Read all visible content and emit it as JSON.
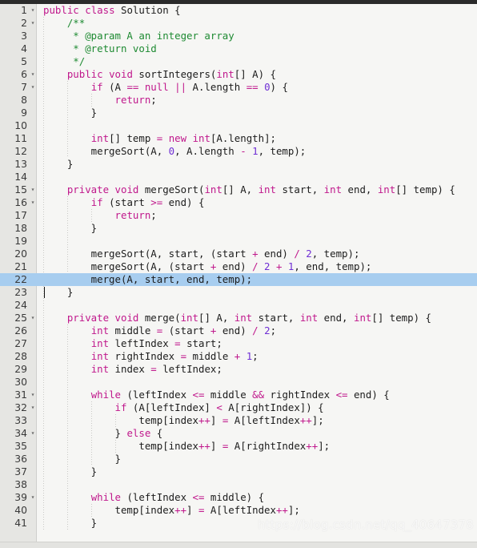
{
  "editor": {
    "language": "java",
    "theme": "light",
    "gutter_width": 46,
    "line_height": 16,
    "highlight_line": 22,
    "cursor_line": 23,
    "colors": {
      "background": "#f6f6f4",
      "gutter": "#e6e6e3",
      "top_bar": "#2b2b2b",
      "bottom_bar": "#e3e3e0",
      "selection": "#a7cdef",
      "keyword": "#c0188c",
      "comment": "#1e8a32",
      "number": "#6f2fd4",
      "operator": "#c0188c",
      "plain": "#1c1c1c",
      "line_number": "#3a3a3a"
    }
  },
  "watermark": {
    "text": "https://blog.csdn.net/qq_40647378"
  },
  "lines": [
    {
      "n": "1",
      "fold": true,
      "indent": 0,
      "tokens": [
        {
          "t": "public",
          "c": "kw"
        },
        {
          "t": " ",
          "c": "pl"
        },
        {
          "t": "class",
          "c": "kw"
        },
        {
          "t": " Solution {",
          "c": "pl"
        }
      ]
    },
    {
      "n": "2",
      "fold": true,
      "indent": 1,
      "tokens": [
        {
          "t": "    /**",
          "c": "cmt"
        }
      ]
    },
    {
      "n": "3",
      "fold": false,
      "indent": 1,
      "tokens": [
        {
          "t": "     * @param A an integer array",
          "c": "cmt"
        }
      ]
    },
    {
      "n": "4",
      "fold": false,
      "indent": 1,
      "tokens": [
        {
          "t": "     * @return void",
          "c": "cmt"
        }
      ]
    },
    {
      "n": "5",
      "fold": false,
      "indent": 1,
      "tokens": [
        {
          "t": "     */",
          "c": "cmt"
        }
      ]
    },
    {
      "n": "6",
      "fold": true,
      "indent": 1,
      "tokens": [
        {
          "t": "    ",
          "c": "pl"
        },
        {
          "t": "public",
          "c": "kw"
        },
        {
          "t": " ",
          "c": "pl"
        },
        {
          "t": "void",
          "c": "kw"
        },
        {
          "t": " sortIntegers(",
          "c": "pl"
        },
        {
          "t": "int",
          "c": "type"
        },
        {
          "t": "[] A) {",
          "c": "pl"
        }
      ]
    },
    {
      "n": "7",
      "fold": true,
      "indent": 2,
      "tokens": [
        {
          "t": "        ",
          "c": "pl"
        },
        {
          "t": "if",
          "c": "kw"
        },
        {
          "t": " (A ",
          "c": "pl"
        },
        {
          "t": "==",
          "c": "op"
        },
        {
          "t": " ",
          "c": "pl"
        },
        {
          "t": "null",
          "c": "kw"
        },
        {
          "t": " ",
          "c": "pl"
        },
        {
          "t": "||",
          "c": "op"
        },
        {
          "t": " A.length ",
          "c": "pl"
        },
        {
          "t": "==",
          "c": "op"
        },
        {
          "t": " ",
          "c": "pl"
        },
        {
          "t": "0",
          "c": "num"
        },
        {
          "t": ") {",
          "c": "pl"
        }
      ]
    },
    {
      "n": "8",
      "fold": false,
      "indent": 3,
      "tokens": [
        {
          "t": "            ",
          "c": "pl"
        },
        {
          "t": "return",
          "c": "kw"
        },
        {
          "t": ";",
          "c": "pl"
        }
      ]
    },
    {
      "n": "9",
      "fold": false,
      "indent": 2,
      "tokens": [
        {
          "t": "        }",
          "c": "pl"
        }
      ]
    },
    {
      "n": "10",
      "fold": false,
      "indent": 0,
      "tokens": [
        {
          "t": "",
          "c": "pl"
        }
      ]
    },
    {
      "n": "11",
      "fold": false,
      "indent": 2,
      "tokens": [
        {
          "t": "        ",
          "c": "pl"
        },
        {
          "t": "int",
          "c": "type"
        },
        {
          "t": "[] temp ",
          "c": "pl"
        },
        {
          "t": "=",
          "c": "op"
        },
        {
          "t": " ",
          "c": "pl"
        },
        {
          "t": "new",
          "c": "kw"
        },
        {
          "t": " ",
          "c": "pl"
        },
        {
          "t": "int",
          "c": "type"
        },
        {
          "t": "[A.length];",
          "c": "pl"
        }
      ]
    },
    {
      "n": "12",
      "fold": false,
      "indent": 2,
      "tokens": [
        {
          "t": "        mergeSort(A, ",
          "c": "pl"
        },
        {
          "t": "0",
          "c": "num"
        },
        {
          "t": ", A.length ",
          "c": "pl"
        },
        {
          "t": "-",
          "c": "op"
        },
        {
          "t": " ",
          "c": "pl"
        },
        {
          "t": "1",
          "c": "num"
        },
        {
          "t": ", temp);",
          "c": "pl"
        }
      ]
    },
    {
      "n": "13",
      "fold": false,
      "indent": 1,
      "tokens": [
        {
          "t": "    }",
          "c": "pl"
        }
      ]
    },
    {
      "n": "14",
      "fold": false,
      "indent": 0,
      "tokens": [
        {
          "t": "",
          "c": "pl"
        }
      ]
    },
    {
      "n": "15",
      "fold": true,
      "indent": 1,
      "tokens": [
        {
          "t": "    ",
          "c": "pl"
        },
        {
          "t": "private",
          "c": "kw"
        },
        {
          "t": " ",
          "c": "pl"
        },
        {
          "t": "void",
          "c": "kw"
        },
        {
          "t": " mergeSort(",
          "c": "pl"
        },
        {
          "t": "int",
          "c": "type"
        },
        {
          "t": "[] A, ",
          "c": "pl"
        },
        {
          "t": "int",
          "c": "type"
        },
        {
          "t": " start, ",
          "c": "pl"
        },
        {
          "t": "int",
          "c": "type"
        },
        {
          "t": " end, ",
          "c": "pl"
        },
        {
          "t": "int",
          "c": "type"
        },
        {
          "t": "[] temp) {",
          "c": "pl"
        }
      ]
    },
    {
      "n": "16",
      "fold": true,
      "indent": 2,
      "tokens": [
        {
          "t": "        ",
          "c": "pl"
        },
        {
          "t": "if",
          "c": "kw"
        },
        {
          "t": " (start ",
          "c": "pl"
        },
        {
          "t": ">=",
          "c": "op"
        },
        {
          "t": " end) {",
          "c": "pl"
        }
      ]
    },
    {
      "n": "17",
      "fold": false,
      "indent": 3,
      "tokens": [
        {
          "t": "            ",
          "c": "pl"
        },
        {
          "t": "return",
          "c": "kw"
        },
        {
          "t": ";",
          "c": "pl"
        }
      ]
    },
    {
      "n": "18",
      "fold": false,
      "indent": 2,
      "tokens": [
        {
          "t": "        }",
          "c": "pl"
        }
      ]
    },
    {
      "n": "19",
      "fold": false,
      "indent": 0,
      "tokens": [
        {
          "t": "",
          "c": "pl"
        }
      ]
    },
    {
      "n": "20",
      "fold": false,
      "indent": 2,
      "tokens": [
        {
          "t": "        mergeSort(A, start, (start ",
          "c": "pl"
        },
        {
          "t": "+",
          "c": "op"
        },
        {
          "t": " end) ",
          "c": "pl"
        },
        {
          "t": "/",
          "c": "op"
        },
        {
          "t": " ",
          "c": "pl"
        },
        {
          "t": "2",
          "c": "num"
        },
        {
          "t": ", temp);",
          "c": "pl"
        }
      ]
    },
    {
      "n": "21",
      "fold": false,
      "indent": 2,
      "tokens": [
        {
          "t": "        mergeSort(A, (start ",
          "c": "pl"
        },
        {
          "t": "+",
          "c": "op"
        },
        {
          "t": " end) ",
          "c": "pl"
        },
        {
          "t": "/",
          "c": "op"
        },
        {
          "t": " ",
          "c": "pl"
        },
        {
          "t": "2",
          "c": "num"
        },
        {
          "t": " ",
          "c": "pl"
        },
        {
          "t": "+",
          "c": "op"
        },
        {
          "t": " ",
          "c": "pl"
        },
        {
          "t": "1",
          "c": "num"
        },
        {
          "t": ", end, temp);",
          "c": "pl"
        }
      ]
    },
    {
      "n": "22",
      "fold": false,
      "indent": 2,
      "highlight": true,
      "tokens": [
        {
          "t": "        merge(A, start, end, temp);",
          "c": "pl"
        }
      ]
    },
    {
      "n": "23",
      "fold": false,
      "indent": 1,
      "cursor": true,
      "tokens": [
        {
          "t": "    }",
          "c": "pl"
        }
      ]
    },
    {
      "n": "24",
      "fold": false,
      "indent": 0,
      "tokens": [
        {
          "t": "",
          "c": "pl"
        }
      ]
    },
    {
      "n": "25",
      "fold": true,
      "indent": 1,
      "tokens": [
        {
          "t": "    ",
          "c": "pl"
        },
        {
          "t": "private",
          "c": "kw"
        },
        {
          "t": " ",
          "c": "pl"
        },
        {
          "t": "void",
          "c": "kw"
        },
        {
          "t": " merge(",
          "c": "pl"
        },
        {
          "t": "int",
          "c": "type"
        },
        {
          "t": "[] A, ",
          "c": "pl"
        },
        {
          "t": "int",
          "c": "type"
        },
        {
          "t": " start, ",
          "c": "pl"
        },
        {
          "t": "int",
          "c": "type"
        },
        {
          "t": " end, ",
          "c": "pl"
        },
        {
          "t": "int",
          "c": "type"
        },
        {
          "t": "[] temp) {",
          "c": "pl"
        }
      ]
    },
    {
      "n": "26",
      "fold": false,
      "indent": 2,
      "tokens": [
        {
          "t": "        ",
          "c": "pl"
        },
        {
          "t": "int",
          "c": "type"
        },
        {
          "t": " middle ",
          "c": "pl"
        },
        {
          "t": "=",
          "c": "op"
        },
        {
          "t": " (start ",
          "c": "pl"
        },
        {
          "t": "+",
          "c": "op"
        },
        {
          "t": " end) ",
          "c": "pl"
        },
        {
          "t": "/",
          "c": "op"
        },
        {
          "t": " ",
          "c": "pl"
        },
        {
          "t": "2",
          "c": "num"
        },
        {
          "t": ";",
          "c": "pl"
        }
      ]
    },
    {
      "n": "27",
      "fold": false,
      "indent": 2,
      "tokens": [
        {
          "t": "        ",
          "c": "pl"
        },
        {
          "t": "int",
          "c": "type"
        },
        {
          "t": " leftIndex ",
          "c": "pl"
        },
        {
          "t": "=",
          "c": "op"
        },
        {
          "t": " start;",
          "c": "pl"
        }
      ]
    },
    {
      "n": "28",
      "fold": false,
      "indent": 2,
      "tokens": [
        {
          "t": "        ",
          "c": "pl"
        },
        {
          "t": "int",
          "c": "type"
        },
        {
          "t": " rightIndex ",
          "c": "pl"
        },
        {
          "t": "=",
          "c": "op"
        },
        {
          "t": " middle ",
          "c": "pl"
        },
        {
          "t": "+",
          "c": "op"
        },
        {
          "t": " ",
          "c": "pl"
        },
        {
          "t": "1",
          "c": "num"
        },
        {
          "t": ";",
          "c": "pl"
        }
      ]
    },
    {
      "n": "29",
      "fold": false,
      "indent": 2,
      "tokens": [
        {
          "t": "        ",
          "c": "pl"
        },
        {
          "t": "int",
          "c": "type"
        },
        {
          "t": " index ",
          "c": "pl"
        },
        {
          "t": "=",
          "c": "op"
        },
        {
          "t": " leftIndex;",
          "c": "pl"
        }
      ]
    },
    {
      "n": "30",
      "fold": false,
      "indent": 0,
      "tokens": [
        {
          "t": "",
          "c": "pl"
        }
      ]
    },
    {
      "n": "31",
      "fold": true,
      "indent": 2,
      "tokens": [
        {
          "t": "        ",
          "c": "pl"
        },
        {
          "t": "while",
          "c": "kw"
        },
        {
          "t": " (leftIndex ",
          "c": "pl"
        },
        {
          "t": "<=",
          "c": "op"
        },
        {
          "t": " middle ",
          "c": "pl"
        },
        {
          "t": "&&",
          "c": "op"
        },
        {
          "t": " rightIndex ",
          "c": "pl"
        },
        {
          "t": "<=",
          "c": "op"
        },
        {
          "t": " end) {",
          "c": "pl"
        }
      ]
    },
    {
      "n": "32",
      "fold": true,
      "indent": 3,
      "tokens": [
        {
          "t": "            ",
          "c": "pl"
        },
        {
          "t": "if",
          "c": "kw"
        },
        {
          "t": " (A[leftIndex] ",
          "c": "pl"
        },
        {
          "t": "<",
          "c": "op"
        },
        {
          "t": " A[rightIndex]) {",
          "c": "pl"
        }
      ]
    },
    {
      "n": "33",
      "fold": false,
      "indent": 4,
      "tokens": [
        {
          "t": "                temp[index",
          "c": "pl"
        },
        {
          "t": "++",
          "c": "op"
        },
        {
          "t": "] ",
          "c": "pl"
        },
        {
          "t": "=",
          "c": "op"
        },
        {
          "t": " A[leftIndex",
          "c": "pl"
        },
        {
          "t": "++",
          "c": "op"
        },
        {
          "t": "];",
          "c": "pl"
        }
      ]
    },
    {
      "n": "34",
      "fold": true,
      "indent": 3,
      "tokens": [
        {
          "t": "            } ",
          "c": "pl"
        },
        {
          "t": "else",
          "c": "kw"
        },
        {
          "t": " {",
          "c": "pl"
        }
      ]
    },
    {
      "n": "35",
      "fold": false,
      "indent": 4,
      "tokens": [
        {
          "t": "                temp[index",
          "c": "pl"
        },
        {
          "t": "++",
          "c": "op"
        },
        {
          "t": "] ",
          "c": "pl"
        },
        {
          "t": "=",
          "c": "op"
        },
        {
          "t": " A[rightIndex",
          "c": "pl"
        },
        {
          "t": "++",
          "c": "op"
        },
        {
          "t": "];",
          "c": "pl"
        }
      ]
    },
    {
      "n": "36",
      "fold": false,
      "indent": 3,
      "tokens": [
        {
          "t": "            }",
          "c": "pl"
        }
      ]
    },
    {
      "n": "37",
      "fold": false,
      "indent": 2,
      "tokens": [
        {
          "t": "        }",
          "c": "pl"
        }
      ]
    },
    {
      "n": "38",
      "fold": false,
      "indent": 0,
      "tokens": [
        {
          "t": "",
          "c": "pl"
        }
      ]
    },
    {
      "n": "39",
      "fold": true,
      "indent": 2,
      "tokens": [
        {
          "t": "        ",
          "c": "pl"
        },
        {
          "t": "while",
          "c": "kw"
        },
        {
          "t": " (leftIndex ",
          "c": "pl"
        },
        {
          "t": "<=",
          "c": "op"
        },
        {
          "t": " middle) {",
          "c": "pl"
        }
      ]
    },
    {
      "n": "40",
      "fold": false,
      "indent": 3,
      "tokens": [
        {
          "t": "            temp[index",
          "c": "pl"
        },
        {
          "t": "++",
          "c": "op"
        },
        {
          "t": "] ",
          "c": "pl"
        },
        {
          "t": "=",
          "c": "op"
        },
        {
          "t": " A[leftIndex",
          "c": "pl"
        },
        {
          "t": "++",
          "c": "op"
        },
        {
          "t": "];",
          "c": "pl"
        }
      ]
    },
    {
      "n": "41",
      "fold": false,
      "indent": 2,
      "tokens": [
        {
          "t": "        }",
          "c": "pl"
        }
      ]
    }
  ]
}
